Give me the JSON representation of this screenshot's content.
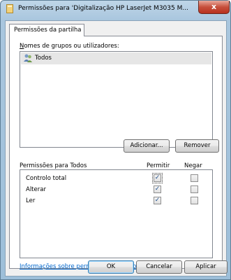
{
  "window": {
    "title": "Permissões para 'Digitalização HP LaserJet M3035 M...",
    "close_symbol": "x",
    "folder_icon": "folder-icon"
  },
  "tabs": [
    {
      "label": "Permissões da partilha",
      "selected": true
    }
  ],
  "groups": {
    "label": "Nomes de grupos ou utilizadores:",
    "items": [
      {
        "name": "Todos",
        "icon": "users-icon",
        "selected": true
      }
    ]
  },
  "buttons": {
    "add": "Adicionar...",
    "remove": "Remover",
    "ok": "OK",
    "cancel": "Cancelar",
    "apply": "Aplicar"
  },
  "permissions": {
    "header": "Permissões para Todos",
    "col_allow": "Permitir",
    "col_deny": "Negar",
    "rows": [
      {
        "name": "Controlo total",
        "allow": true,
        "deny": false
      },
      {
        "name": "Alterar",
        "allow": true,
        "deny": false
      },
      {
        "name": "Ler",
        "allow": true,
        "deny": false
      }
    ]
  },
  "info_link": "Informações sobre permissões e controlo de acesso",
  "colors": {
    "link": "#0066cc",
    "close": "#c7503c",
    "selection": "#e6e6e6"
  }
}
